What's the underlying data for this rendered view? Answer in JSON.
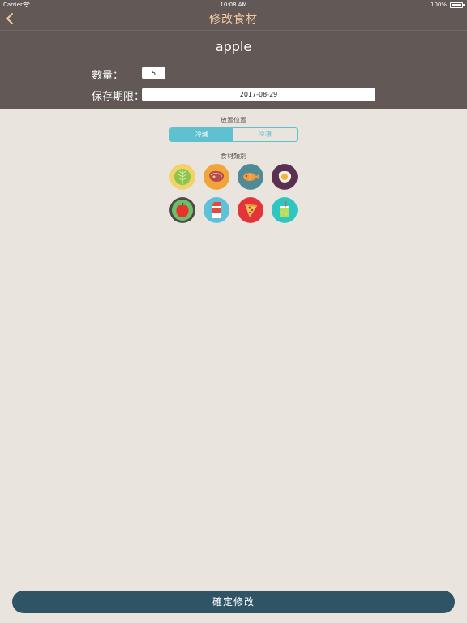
{
  "status_bar": {
    "carrier": "Carrier",
    "time": "10:08 AM",
    "battery": "100%"
  },
  "nav": {
    "title": "修改食材",
    "back_icon": "chevron-left-icon"
  },
  "food": {
    "name": "apple",
    "quantity_label": "數量：",
    "quantity_value": "5",
    "expiry_label": "保存期限：",
    "expiry_value": "2017-08-29"
  },
  "storage": {
    "label": "放置位置",
    "options": [
      "冷藏",
      "冷凍"
    ],
    "selected": "冷藏"
  },
  "category": {
    "label": "食材類別",
    "icons": [
      "lettuce-icon",
      "steak-icon",
      "fish-icon",
      "egg-icon",
      "apple-icon",
      "milk-carton-icon",
      "pizza-icon",
      "drink-icon"
    ]
  },
  "actions": {
    "confirm_label": "確定修改"
  },
  "colors": {
    "header_bg": "#625856",
    "title_color": "#f3c7a0",
    "accent": "#5fc1cf",
    "button_bg": "#2f5466",
    "page_bg": "#e9e4de"
  }
}
